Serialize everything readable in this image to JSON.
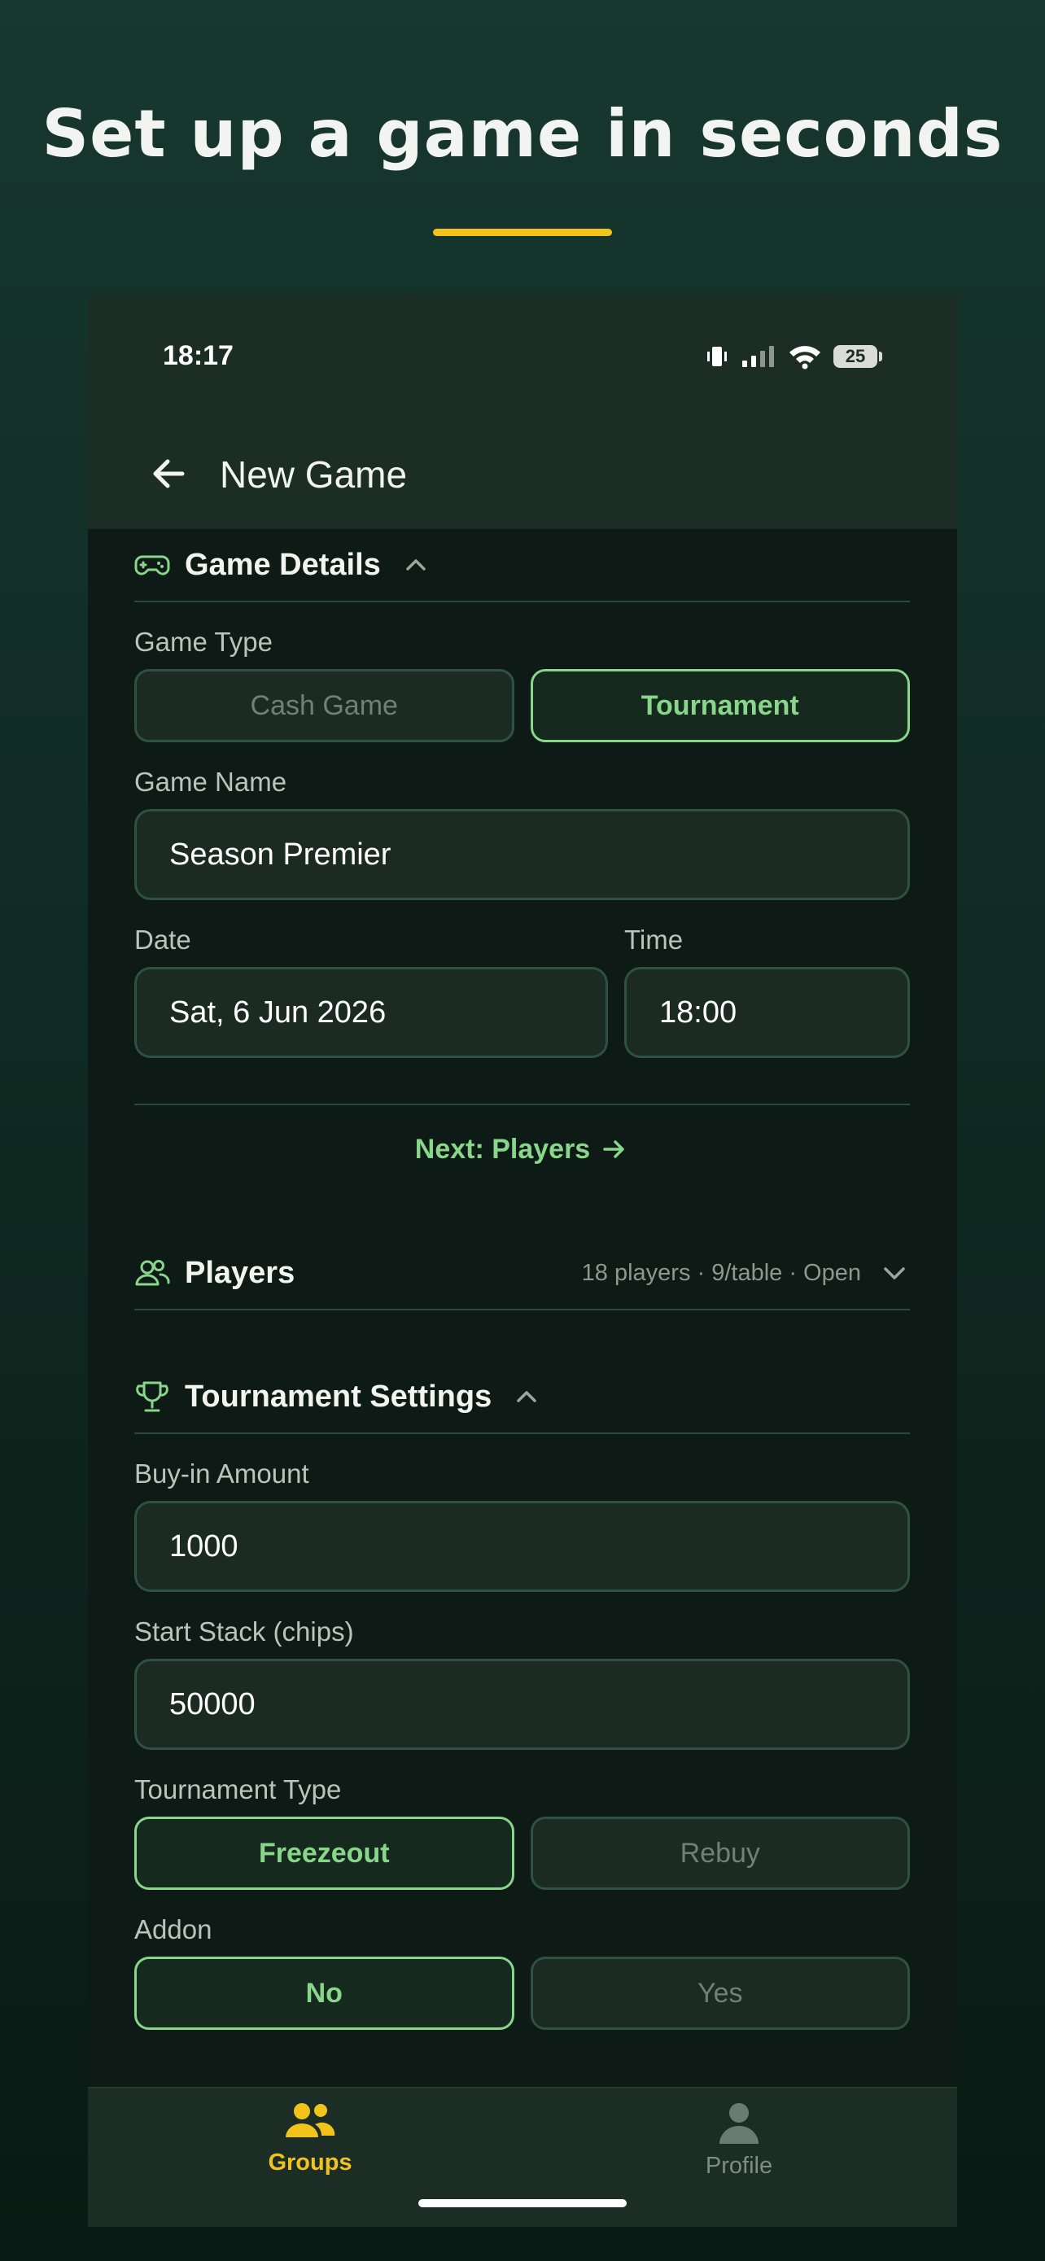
{
  "headline": "Set up a game in seconds",
  "colors": {
    "accent": "#88d68a",
    "highlight": "#f2c31b",
    "background": "#0d1a15"
  },
  "status_bar": {
    "time": "18:17",
    "battery": "25",
    "icons": [
      "vibrate-icon",
      "signal-icon",
      "wifi-icon",
      "battery-icon"
    ]
  },
  "appbar": {
    "title": "New Game"
  },
  "game_details": {
    "title": "Game Details",
    "game_type_label": "Game Type",
    "game_type_options": [
      "Cash Game",
      "Tournament"
    ],
    "game_type_selected": "Tournament",
    "game_name_label": "Game Name",
    "game_name_value": "Season Premier",
    "date_label": "Date",
    "date_value": "Sat, 6 Jun 2026",
    "time_label": "Time",
    "time_value": "18:00",
    "next_label": "Next: Players"
  },
  "players": {
    "title": "Players",
    "summary": "18 players · 9/table · Open"
  },
  "tournament_settings": {
    "title": "Tournament Settings",
    "buyin_label": "Buy-in Amount",
    "buyin_value": "1000",
    "stack_label": "Start Stack (chips)",
    "stack_value": "50000",
    "type_label": "Tournament Type",
    "type_options": [
      "Freezeout",
      "Rebuy"
    ],
    "type_selected": "Freezeout",
    "addon_label": "Addon",
    "addon_options": [
      "No",
      "Yes"
    ],
    "addon_selected": "No"
  },
  "bottom_nav": {
    "items": [
      {
        "label": "Groups",
        "icon": "groups-icon",
        "active": true
      },
      {
        "label": "Profile",
        "icon": "profile-icon",
        "active": false
      }
    ]
  }
}
